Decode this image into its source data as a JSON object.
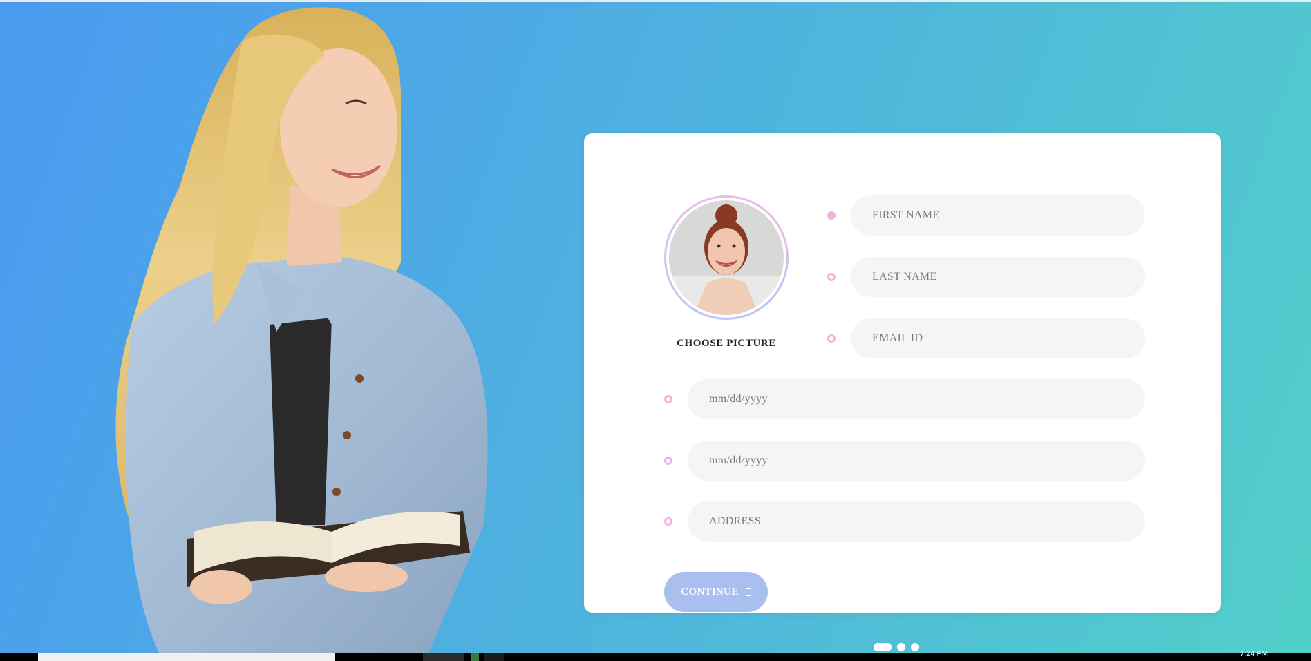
{
  "colors": {
    "gradient_start": "#4a9af0",
    "gradient_end": "#52cfca",
    "card": "#ffffff",
    "field_bg": "#f5f5f5",
    "dot": "#f0b2e1",
    "button": "#a9bff0"
  },
  "profile": {
    "choose_picture_label": "CHOOSE PICTURE"
  },
  "fields": {
    "first_name": {
      "placeholder": "FIRST NAME",
      "value": ""
    },
    "last_name": {
      "placeholder": "LAST NAME",
      "value": ""
    },
    "email": {
      "placeholder": "EMAIL ID",
      "value": ""
    },
    "date_1": {
      "placeholder": "mm/dd/yyyy",
      "value": ""
    },
    "date_2": {
      "placeholder": "mm/dd/yyyy",
      "value": ""
    },
    "address": {
      "placeholder": "ADDRESS",
      "value": ""
    }
  },
  "actions": {
    "continue_label": "CONTINUE",
    "continue_icon": "square-icon"
  },
  "pager": {
    "current": 1,
    "total": 3
  },
  "taskbar": {
    "clock": "7:24 PM"
  }
}
